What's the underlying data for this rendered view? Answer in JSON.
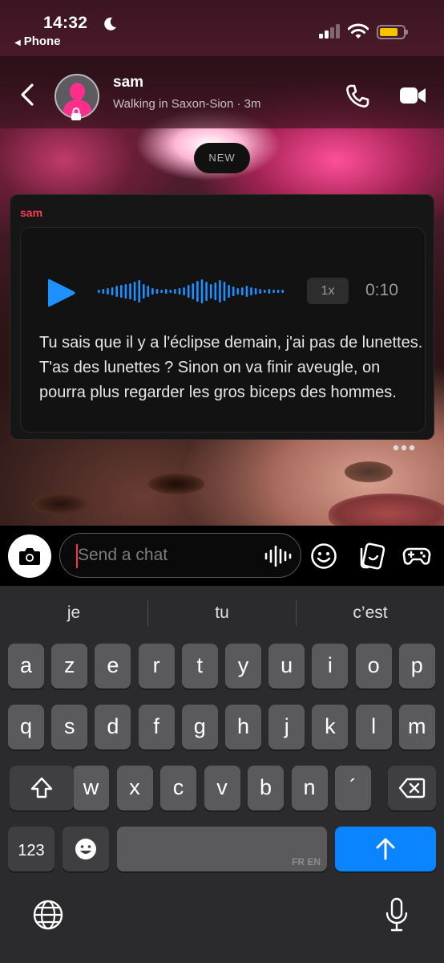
{
  "status_bar": {
    "time": "14:32",
    "back_app": "Phone",
    "battery_level": 0.8,
    "battery_color": "#f5c400"
  },
  "header": {
    "contact_name": "sam",
    "subtitle": "Walking in Saxon-Sion · 3m",
    "icons": [
      "back-chevron-icon",
      "bitmoji-avatar",
      "lock-icon",
      "phone-call-icon",
      "video-call-icon"
    ]
  },
  "new_badge": "NEW",
  "message": {
    "sender": "sam",
    "sender_color": "#f23c57",
    "voice_note": {
      "speed": "1x",
      "duration": "0:10",
      "accent_color": "#1e90ff"
    },
    "transcript": "Tu sais que il y a l'éclipse demain, j'ai pas de lunettes. T'as des lunettes ? Sinon on va finir aveugle, on pourra plus regarder les gros biceps des hommes."
  },
  "chat_input": {
    "placeholder": "Send a chat",
    "icons": [
      "camera-icon",
      "voice-waveform-icon",
      "emoji-icon",
      "sticker-icon",
      "game-controller-icon"
    ]
  },
  "keyboard": {
    "suggestions": [
      "je",
      "tu",
      "c’est"
    ],
    "row1": [
      "a",
      "z",
      "e",
      "r",
      "t",
      "y",
      "u",
      "i",
      "o",
      "p"
    ],
    "row2": [
      "q",
      "s",
      "d",
      "f",
      "g",
      "h",
      "j",
      "k",
      "l",
      "m"
    ],
    "row3": [
      "w",
      "x",
      "c",
      "v",
      "b",
      "n",
      "´"
    ],
    "numbers_key": "123",
    "space_language": "FR EN",
    "return_color": "#0a84ff"
  }
}
